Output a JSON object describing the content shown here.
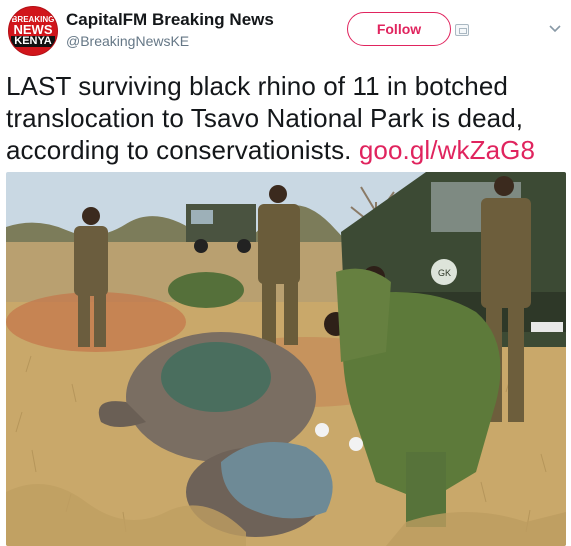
{
  "account": {
    "display_name": "CapitalFM Breaking News",
    "handle": "@BreakingNewsKE",
    "avatar_text": [
      "BREAKING",
      "NEWS",
      "KENYA"
    ]
  },
  "actions": {
    "follow_label": "Follow"
  },
  "tweet": {
    "text_lines": [
      "LAST surviving black rhino of 11 in botched",
      "translocation to Tsavo National Park is dead,",
      "according to conservationists. "
    ],
    "link": "goo.gl/wkZaG8"
  },
  "colors": {
    "accent": "#e0245e",
    "avatar_red": "#d1151b",
    "name_text": "#14171a",
    "handle_text": "#657786"
  },
  "icons": {
    "menu": "chevron-down-icon",
    "follow_extra": "follow-card-icon"
  },
  "photo": {
    "vehicle_plate": "GK"
  }
}
